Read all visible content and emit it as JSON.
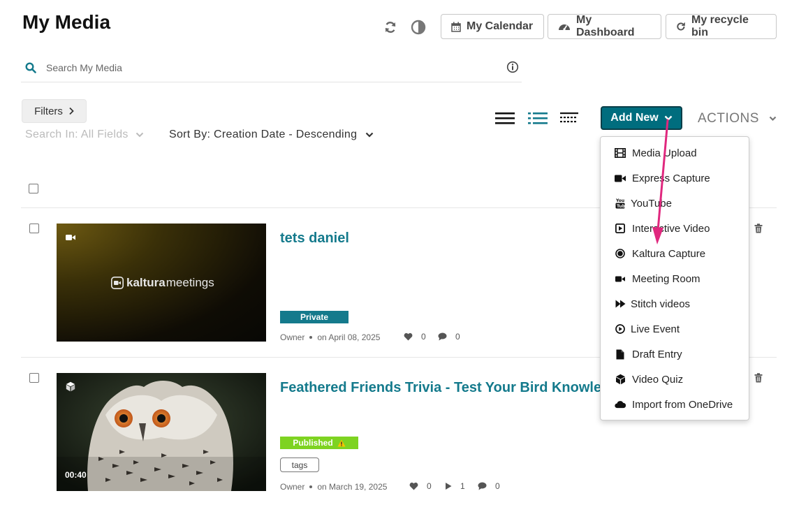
{
  "header": {
    "title": "My Media",
    "buttons": {
      "calendar": "My Calendar",
      "dashboard": "My Dashboard",
      "recycle": "My recycle bin"
    }
  },
  "search": {
    "placeholder": "Search My Media"
  },
  "filters": {
    "label": "Filters",
    "search_in": "Search In: All Fields",
    "sort_by": "Sort By: Creation Date - Descending"
  },
  "toolbar": {
    "add_new": "Add New",
    "actions": "ACTIONS"
  },
  "add_new_menu": [
    {
      "label": "Media Upload",
      "icon": "film-icon"
    },
    {
      "label": "Express Capture",
      "icon": "video-camera-icon"
    },
    {
      "label": "YouTube",
      "icon": "youtube-icon"
    },
    {
      "label": "Interactive Video",
      "icon": "play-square-icon"
    },
    {
      "label": "Kaltura Capture",
      "icon": "record-icon"
    },
    {
      "label": "Meeting Room",
      "icon": "video-camera-small-icon"
    },
    {
      "label": "Stitch videos",
      "icon": "fast-forward-icon"
    },
    {
      "label": "Live Event",
      "icon": "play-circle-icon"
    },
    {
      "label": "Draft Entry",
      "icon": "file-icon"
    },
    {
      "label": "Video Quiz",
      "icon": "cube-icon"
    },
    {
      "label": "Import from OneDrive",
      "icon": "cloud-icon"
    }
  ],
  "entries": [
    {
      "title": "tets daniel",
      "thumb_text": "kaltura",
      "thumb_text_bold": "meetings",
      "status": "Private",
      "status_color": "#147a8c",
      "owner": "Owner",
      "date": "on April 08, 2025",
      "likes": "0",
      "comments": "0"
    },
    {
      "title": "Feathered Friends Trivia - Test Your Bird Knowledge",
      "duration": "00:40",
      "status": "Published",
      "status_color": "#7ed321",
      "tag": "tags",
      "owner": "Owner",
      "date": "on March 19, 2025",
      "likes": "0",
      "plays": "1",
      "comments": "0"
    }
  ],
  "colors": {
    "accent": "#006d7e",
    "title_link": "#147a8c",
    "arrow": "#e0287e"
  }
}
